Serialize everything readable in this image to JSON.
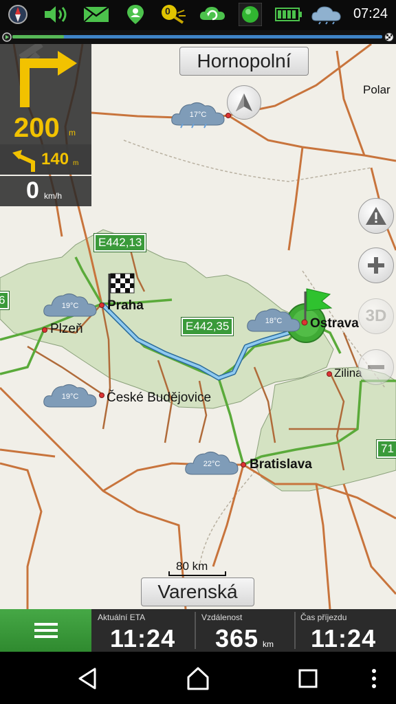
{
  "status_bar": {
    "time": "07:24",
    "badge_count": "0",
    "icons": [
      "compass-icon",
      "volume-icon",
      "mail-icon",
      "contact-pin-icon",
      "satellite-icon",
      "sync-icon",
      "gps-status-icon",
      "battery-icon",
      "weather-icon"
    ]
  },
  "street_top": "Hornopolní",
  "street_bottom": "Varenská",
  "turn": {
    "distance": "200",
    "distance_unit": "m",
    "next_distance": "140",
    "next_unit": "m"
  },
  "speed": {
    "value": "0",
    "unit": "km/h"
  },
  "cities": {
    "praha": "Praha",
    "plzen": "Plzeň",
    "ceske_budejovice": "České Budějovice",
    "ostrava": "Ostrava",
    "zilina": "Zilina",
    "bratislava": "Bratislava",
    "polar": "Polar"
  },
  "road_badges": {
    "e442_13": "E442,13",
    "e442_35": "E442,35",
    "left_edge": "6",
    "right_edge": "71"
  },
  "weather": {
    "north": "17°C",
    "praha": "19°C",
    "budejovice": "19°C",
    "ostrava": "18°C",
    "bratislava": "22°C"
  },
  "scale": "80 km",
  "buttons": {
    "three_d": "3D"
  },
  "bottom": {
    "eta_label": "Aktuální ETA",
    "eta_value": "11:24",
    "distance_label": "Vzdálenost",
    "distance_value": "365",
    "distance_unit": "km",
    "arrival_label": "Čas příjezdu",
    "arrival_value": "11:24"
  },
  "colors": {
    "route": "#6fb8e8",
    "country_fill": "#d4e2c2",
    "road_major": "#c8743c",
    "menu_green": "#3d9a3d"
  }
}
